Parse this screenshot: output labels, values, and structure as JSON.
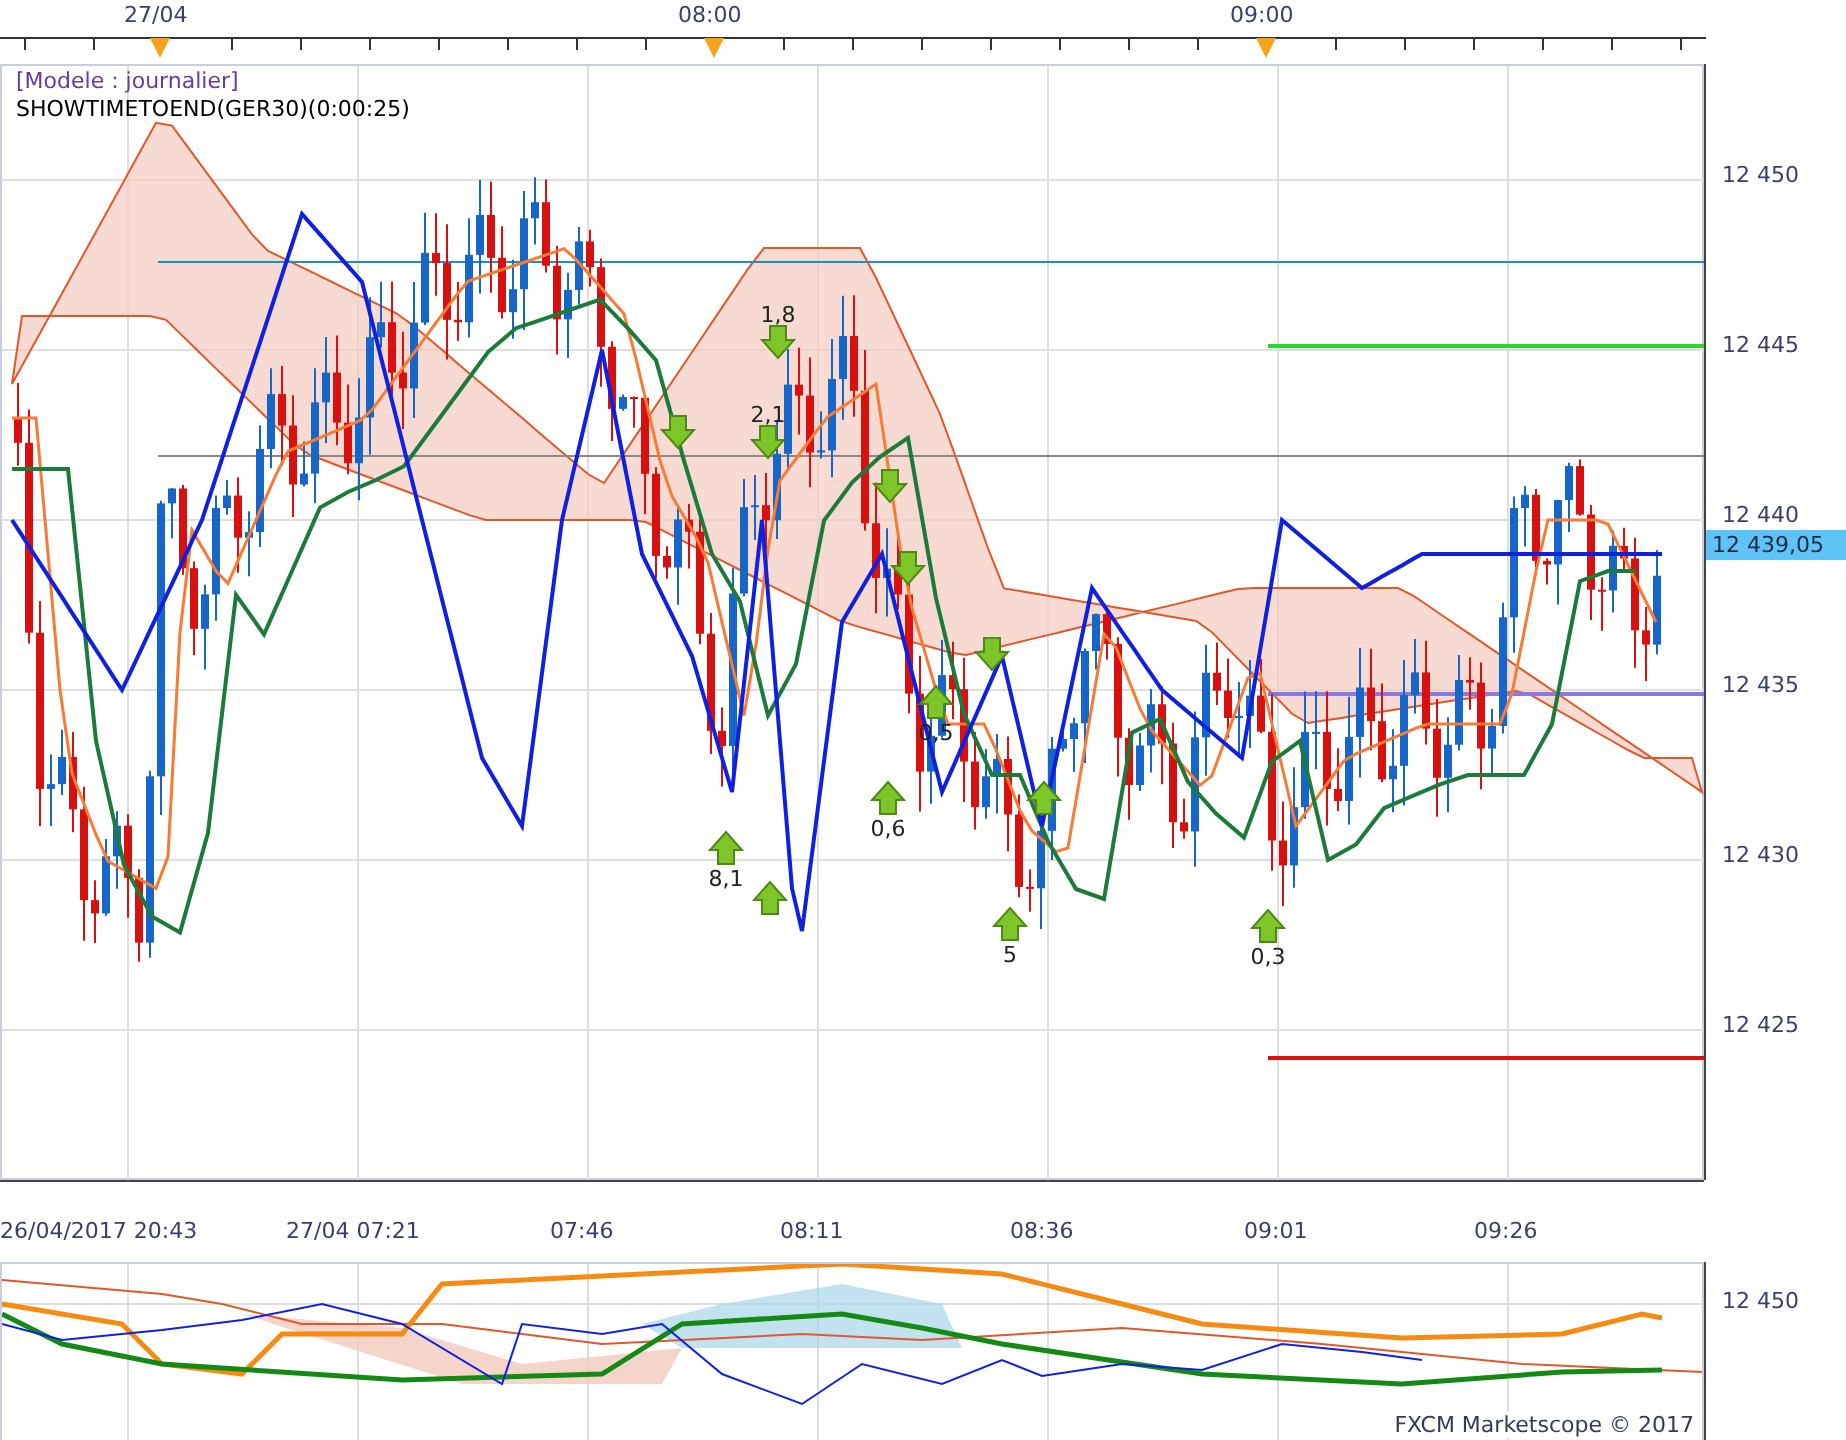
{
  "top_axis": {
    "labels": [
      "27/04",
      "08:00",
      "09:00"
    ]
  },
  "chart": {
    "model_label": "[Modele : journalier]",
    "indicator_label": "SHOWTIMETOEND(GER30)(0:00:25)",
    "price_labels": [
      "12 450",
      "12 445",
      "12 440",
      "12 435",
      "12 430",
      "12 425"
    ],
    "current_price": "12 439,05",
    "signals": [
      {
        "kind": "down",
        "value": "1,8"
      },
      {
        "kind": "down",
        "value": "2,1"
      },
      {
        "kind": "down"
      },
      {
        "kind": "down"
      },
      {
        "kind": "down"
      },
      {
        "kind": "down"
      },
      {
        "kind": "up",
        "value": "8,1"
      },
      {
        "kind": "up"
      },
      {
        "kind": "up",
        "value": "0,6"
      },
      {
        "kind": "up",
        "value": "0,5"
      },
      {
        "kind": "up",
        "value": "5"
      },
      {
        "kind": "up"
      },
      {
        "kind": "up",
        "value": "0,3"
      }
    ],
    "time_labels": [
      "26/04/2017 20:43",
      "27/04 07:21",
      "07:46",
      "08:11",
      "08:36",
      "09:01",
      "09:26"
    ]
  },
  "lower_panel": {
    "price_label": "12 450",
    "copyright": "FXCM Marketscope © 2017"
  }
}
